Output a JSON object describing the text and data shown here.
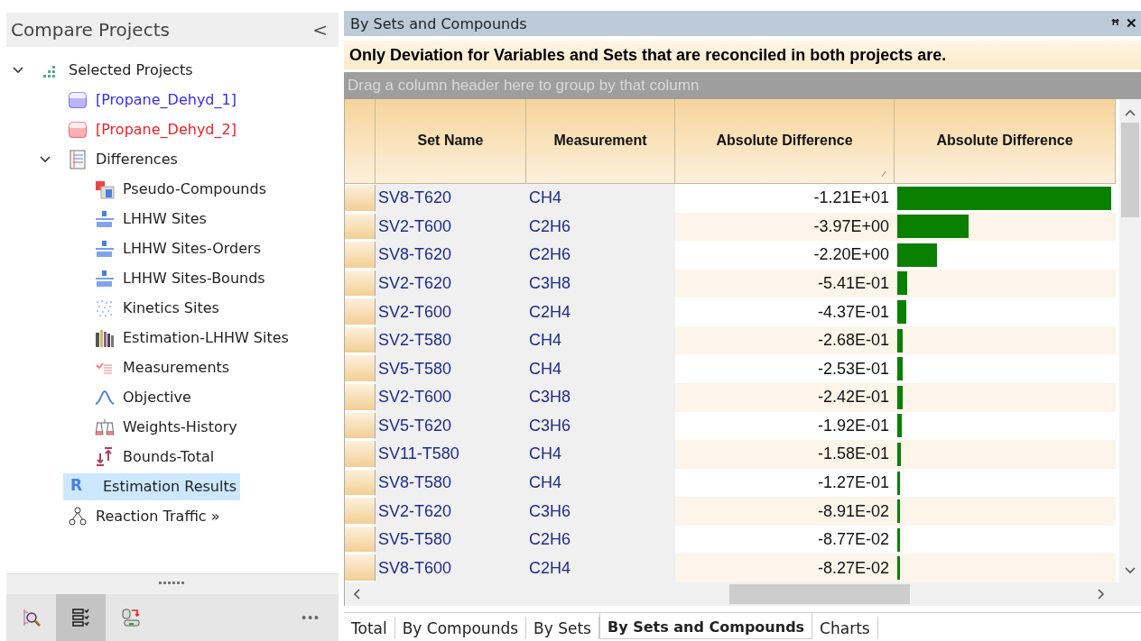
{
  "sidebar": {
    "title": "Compare Projects",
    "collapse": "<",
    "tree": [
      {
        "label": "Selected Projects",
        "expanded": true,
        "children": [
          {
            "label": "[Propane_Dehyd_1]",
            "color": "#3b2bf0",
            "selected": false
          },
          {
            "label": "[Propane_Dehyd_2]",
            "color": "#f0202a",
            "selected": false
          },
          {
            "label": "Differences",
            "expanded": true,
            "selected": false,
            "children": [
              {
                "label": "Pseudo-Compounds",
                "selected": false
              },
              {
                "label": "LHHW Sites",
                "selected": false
              },
              {
                "label": "LHHW Sites-Orders",
                "selected": false
              },
              {
                "label": "LHHW Sites-Bounds",
                "selected": false
              },
              {
                "label": "Kinetics Sites",
                "selected": false
              },
              {
                "label": "Estimation-LHHW Sites",
                "selected": false
              },
              {
                "label": "Measurements",
                "selected": false
              },
              {
                "label": "Objective",
                "selected": false
              },
              {
                "label": "Weights-History",
                "selected": false
              },
              {
                "label": "Bounds-Total",
                "selected": false
              }
            ]
          },
          {
            "label": "Estimation Results",
            "glyph": "R",
            "selected": true
          },
          {
            "label": "Reaction Traffic »",
            "selected": false
          }
        ]
      }
    ],
    "toolbar": [
      {
        "selected": false
      },
      {
        "selected": true
      },
      {
        "selected": false
      }
    ],
    "more": "•••"
  },
  "panel": {
    "title": "By Sets and Compounds",
    "pin": "ꟸ",
    "close": "✕",
    "notice": "Only Deviation for Variables and Sets that are reconciled in both projects are.",
    "group_hint": "Drag a column header here to group by that column",
    "columns": [
      "Set Name",
      "Measurement",
      "Absolute Difference",
      "Absolute Difference"
    ],
    "rows": [
      {
        "set": "SV8-T620",
        "measurement": "CH4",
        "value": "-1.21E+01",
        "level": 0.98
      },
      {
        "set": "SV2-T600",
        "measurement": "C2H6",
        "value": "-3.97E+00",
        "level": 0.325
      },
      {
        "set": "SV8-T620",
        "measurement": "C2H6",
        "value": "-2.20E+00",
        "level": 0.18
      },
      {
        "set": "SV2-T620",
        "measurement": "C3H8",
        "value": "-5.41E-01",
        "level": 0.045
      },
      {
        "set": "SV2-T600",
        "measurement": "C2H4",
        "value": "-4.37E-01",
        "level": 0.042
      },
      {
        "set": "SV2-T580",
        "measurement": "CH4",
        "value": "-2.68E-01",
        "level": 0.025
      },
      {
        "set": "SV5-T580",
        "measurement": "CH4",
        "value": "-2.53E-01",
        "level": 0.024
      },
      {
        "set": "SV2-T600",
        "measurement": "C3H8",
        "value": "-2.42E-01",
        "level": 0.023
      },
      {
        "set": "SV5-T620",
        "measurement": "C3H6",
        "value": "-1.92E-01",
        "level": 0.02
      },
      {
        "set": "SV11-T580",
        "measurement": "CH4",
        "value": "-1.58E-01",
        "level": 0.016
      },
      {
        "set": "SV8-T580",
        "measurement": "CH4",
        "value": "-1.27E-01",
        "level": 0.014
      },
      {
        "set": "SV2-T620",
        "measurement": "C3H6",
        "value": "-8.91E-02",
        "level": 0.011
      },
      {
        "set": "SV5-T580",
        "measurement": "C2H6",
        "value": "-8.77E-02",
        "level": 0.011
      },
      {
        "set": "SV8-T600",
        "measurement": "C2H4",
        "value": "-8.27E-02",
        "level": 0.01
      }
    ],
    "tabs": [
      {
        "label": "Total",
        "selected": false
      },
      {
        "label": "By Compounds",
        "selected": false
      },
      {
        "label": "By Sets",
        "selected": false
      },
      {
        "label": "By Sets and Compounds",
        "selected": true
      },
      {
        "label": "Charts",
        "selected": false
      }
    ]
  }
}
